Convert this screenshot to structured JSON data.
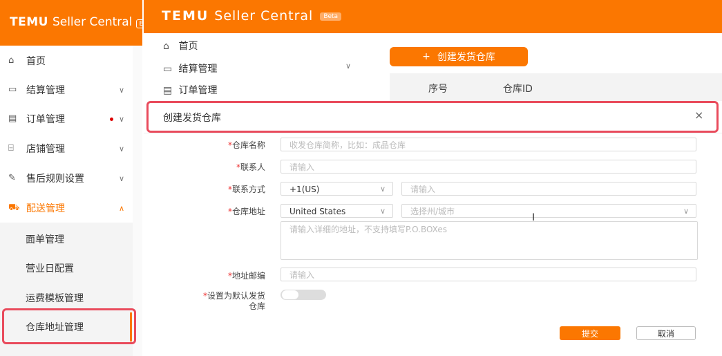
{
  "left_panel": {
    "brand": "TEMU",
    "title": "Seller Central",
    "beta": "Beta",
    "nav": [
      {
        "label": "首页",
        "icon": "home-icon"
      },
      {
        "label": "结算管理",
        "icon": "wallet-icon"
      },
      {
        "label": "订单管理",
        "icon": "order-icon"
      },
      {
        "label": "店铺管理",
        "icon": "store-icon"
      },
      {
        "label": "售后规则设置",
        "icon": "rules-icon"
      },
      {
        "label": "配送管理",
        "icon": "delivery-icon"
      }
    ],
    "sub_nav": [
      "面单管理",
      "营业日配置",
      "运费模板管理",
      "仓库地址管理"
    ]
  },
  "right_panel": {
    "brand": "TEMU",
    "title": "Seller Central",
    "beta": "Beta",
    "nav": [
      "首页",
      "结算管理",
      "订单管理"
    ],
    "create_button": "创建发货仓库",
    "table_headers": [
      "序号",
      "仓库ID"
    ]
  },
  "modal": {
    "title": "创建发货仓库",
    "close": "×",
    "fields": {
      "name_label": "仓库名称",
      "name_placeholder": "收发仓库简称，比如：成品仓库",
      "contact_label": "联系人",
      "contact_placeholder": "请输入",
      "phone_label": "联系方式",
      "phone_code": "+1(US)",
      "phone_placeholder": "请输入",
      "address_label": "仓库地址",
      "country": "United States",
      "state_placeholder": "选择州/城市",
      "detail_placeholder": "请输入详细的地址，不支持填写P.O.BOXes",
      "zip_label": "地址邮编",
      "zip_placeholder": "请输入",
      "default_label_1": "设置为默认发货",
      "default_label_2": "仓库"
    },
    "submit": "提交",
    "cancel": "取消"
  },
  "colors": {
    "brand": "#fb7701",
    "highlight": "#e94b5c"
  }
}
